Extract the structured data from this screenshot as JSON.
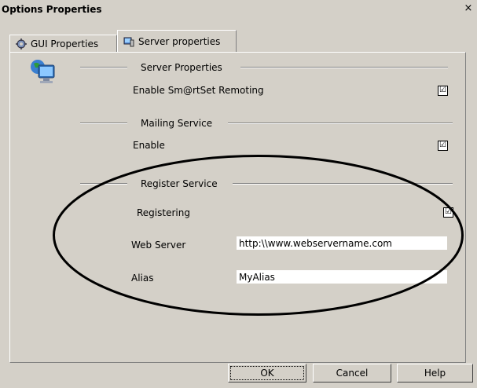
{
  "window": {
    "title": "Options Properties",
    "close_label": "×"
  },
  "tabs": [
    {
      "label": "GUI Properties"
    },
    {
      "label": "Server properties"
    }
  ],
  "server_properties": {
    "section_title": "Server Properties",
    "remoting_label": "Enable Sm@rtSet Remoting",
    "remoting_checked": "☑"
  },
  "mailing": {
    "section_title": "Mailing Service",
    "enable_label": "Enable",
    "enable_checked": "☑"
  },
  "register": {
    "section_title": "Register Service",
    "registering_label": "Registering",
    "registering_checked": "☑",
    "web_server_label": "Web Server",
    "web_server_value": "http:\\\\www.webservername.com",
    "alias_label": "Alias",
    "alias_value": "MyAlias"
  },
  "buttons": {
    "ok": "OK",
    "cancel": "Cancel",
    "help": "Help"
  }
}
